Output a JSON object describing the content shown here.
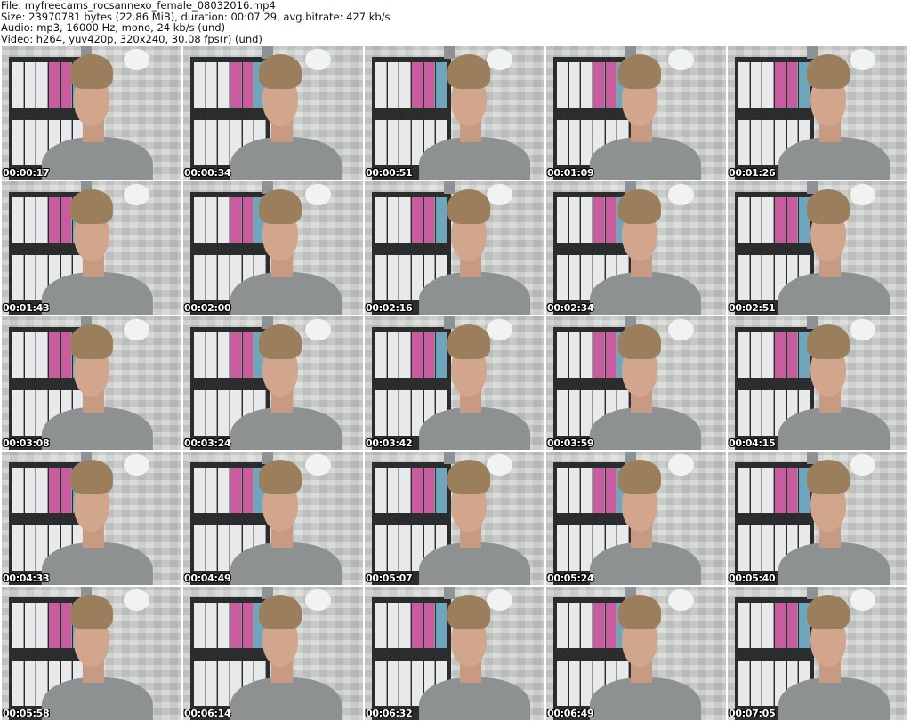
{
  "header": {
    "file": "File: myfreecams_rocsannexo_female_08032016.mp4",
    "size": "Size: 23970781 bytes (22.86 MiB), duration: 00:07:29, avg.bitrate: 427 kb/s",
    "audio": "Audio: mp3, 16000 Hz, mono, 24 kb/s (und)",
    "video": "Video: h264, yuv420p, 320x240, 30.08 fps(r) (und)"
  },
  "thumbnails": [
    {
      "timestamp": "00:00:17"
    },
    {
      "timestamp": "00:00:34"
    },
    {
      "timestamp": "00:00:51"
    },
    {
      "timestamp": "00:01:09"
    },
    {
      "timestamp": "00:01:26"
    },
    {
      "timestamp": "00:01:43"
    },
    {
      "timestamp": "00:02:00"
    },
    {
      "timestamp": "00:02:16"
    },
    {
      "timestamp": "00:02:34"
    },
    {
      "timestamp": "00:02:51"
    },
    {
      "timestamp": "00:03:08"
    },
    {
      "timestamp": "00:03:24"
    },
    {
      "timestamp": "00:03:42"
    },
    {
      "timestamp": "00:03:59"
    },
    {
      "timestamp": "00:04:15"
    },
    {
      "timestamp": "00:04:33"
    },
    {
      "timestamp": "00:04:49"
    },
    {
      "timestamp": "00:05:07"
    },
    {
      "timestamp": "00:05:24"
    },
    {
      "timestamp": "00:05:40"
    },
    {
      "timestamp": "00:05:58"
    },
    {
      "timestamp": "00:06:14"
    },
    {
      "timestamp": "00:06:32"
    },
    {
      "timestamp": "00:06:49"
    },
    {
      "timestamp": "00:07:05"
    }
  ]
}
